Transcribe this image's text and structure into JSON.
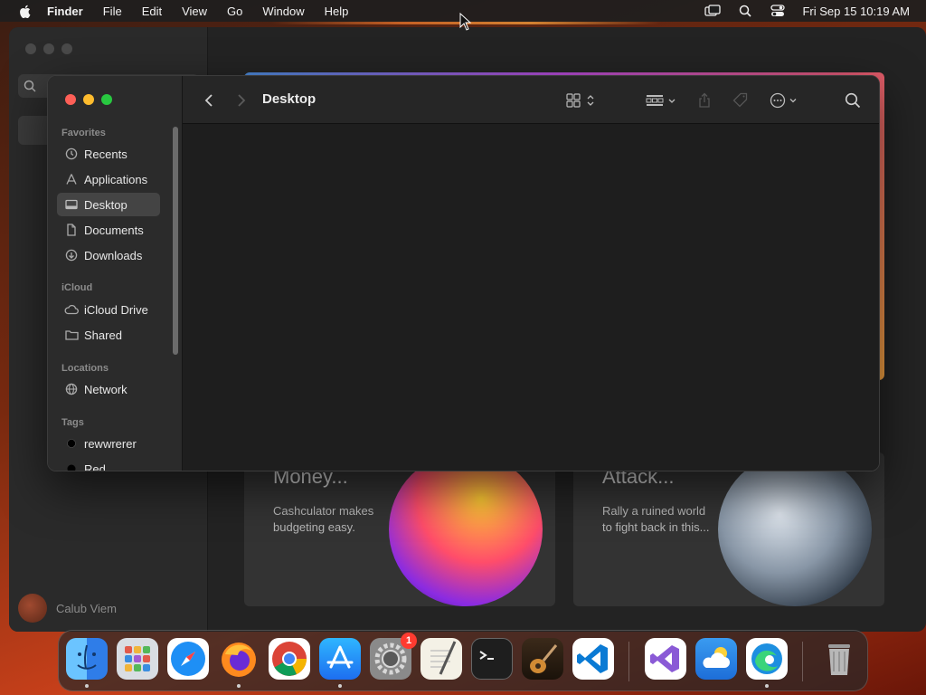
{
  "menubar": {
    "app_name": "Finder",
    "items": [
      "File",
      "Edit",
      "View",
      "Go",
      "Window",
      "Help"
    ],
    "datetime": "Fri Sep 15  10:19 AM"
  },
  "background_app": {
    "user_name": "Calub Viem",
    "cards": [
      {
        "title": "Money...",
        "desc": "Cashculator makes budgeting easy."
      },
      {
        "title": "Attack...",
        "desc": "Rally a ruined world to fight back in this..."
      }
    ]
  },
  "finder": {
    "title": "Desktop",
    "sections": {
      "favorites": "Favorites",
      "icloud": "iCloud",
      "locations": "Locations",
      "tags": "Tags"
    },
    "favorites": [
      {
        "label": "Recents",
        "icon": "clock-icon"
      },
      {
        "label": "Applications",
        "icon": "applications-icon"
      },
      {
        "label": "Desktop",
        "icon": "desktop-icon",
        "selected": true
      },
      {
        "label": "Documents",
        "icon": "document-icon"
      },
      {
        "label": "Downloads",
        "icon": "download-icon"
      }
    ],
    "icloud": [
      {
        "label": "iCloud Drive",
        "icon": "cloud-icon"
      },
      {
        "label": "Shared",
        "icon": "shared-folder-icon"
      }
    ],
    "locations": [
      {
        "label": "Network",
        "icon": "globe-icon"
      }
    ],
    "tags": [
      {
        "label": "rewwrerer",
        "color": "#000000"
      },
      {
        "label": "Red",
        "color": "#ff3b30"
      }
    ]
  },
  "dock": {
    "apps": [
      "Finder",
      "Launchpad",
      "Safari",
      "Firefox",
      "Chrome",
      "App Store",
      "System Settings",
      "TextEdit",
      "Terminal",
      "GarageBand",
      "VS Code",
      "Visual Studio",
      "Weather",
      "Edge",
      "Trash"
    ],
    "settings_badge": "1"
  },
  "colors": {
    "accent": "#0a84ff",
    "close": "#fe5f57",
    "minimize": "#febc2e",
    "maximize": "#28c840"
  }
}
